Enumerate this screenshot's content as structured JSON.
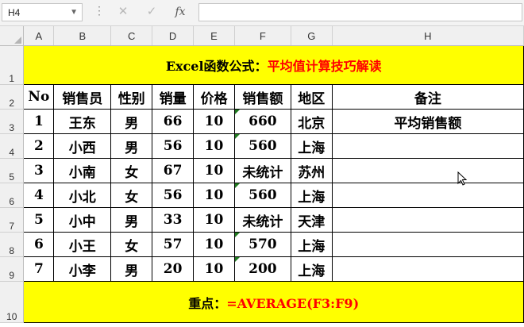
{
  "name_box": "H4",
  "toolbar": {
    "cancel_glyph": "✕",
    "enter_glyph": "✓",
    "fx_label": "fx",
    "formula": ""
  },
  "columns": [
    "A",
    "B",
    "C",
    "D",
    "E",
    "F",
    "G",
    "H"
  ],
  "rows": [
    "1",
    "2",
    "3",
    "4",
    "5",
    "6",
    "7",
    "8",
    "9",
    "10"
  ],
  "title": {
    "black": "Excel函数公式：",
    "red": "平均值计算技巧解读"
  },
  "headers": [
    "No",
    "销售员",
    "性别",
    "销量",
    "价格",
    "销售额",
    "地区",
    "备注"
  ],
  "data": [
    [
      "1",
      "王东",
      "男",
      "66",
      "10",
      "660",
      "北京",
      "平均销售额"
    ],
    [
      "2",
      "小西",
      "男",
      "56",
      "10",
      "560",
      "上海",
      ""
    ],
    [
      "3",
      "小南",
      "女",
      "67",
      "10",
      "未统计",
      "苏州",
      ""
    ],
    [
      "4",
      "小北",
      "女",
      "56",
      "10",
      "560",
      "上海",
      ""
    ],
    [
      "5",
      "小中",
      "男",
      "33",
      "10",
      "未统计",
      "天津",
      ""
    ],
    [
      "6",
      "小王",
      "女",
      "57",
      "10",
      "570",
      "上海",
      ""
    ],
    [
      "7",
      "小李",
      "男",
      "20",
      "10",
      "200",
      "上海",
      ""
    ]
  ],
  "footer": {
    "label": "重点：",
    "formula": "=AVERAGE(F3:F9)"
  },
  "colors": {
    "banner": "#ffff00",
    "accent": "#ff0000",
    "indicator": "#1f7a1f"
  }
}
